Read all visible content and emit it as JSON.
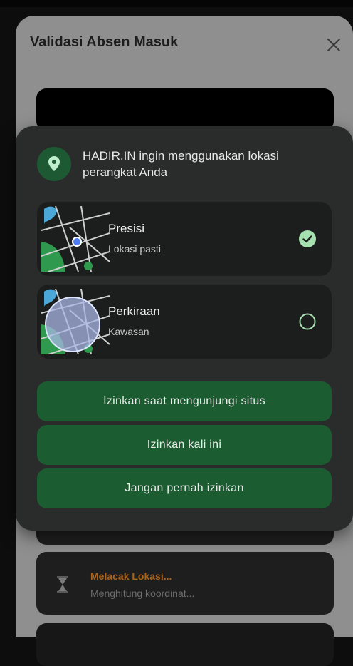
{
  "background": {
    "sheet_title": "Validasi Absen Masuk",
    "tracking_card": {
      "title": "Melacak Lokasi...",
      "subtitle": "Menghitung koordinat..."
    }
  },
  "permission_dialog": {
    "message": "HADIR.IN ingin menggunakan lokasi perangkat Anda",
    "options": [
      {
        "title": "Presisi",
        "subtitle": "Lokasi pasti",
        "selected": true
      },
      {
        "title": "Perkiraan",
        "subtitle": "Kawasan",
        "selected": false
      }
    ],
    "buttons": {
      "while_visiting": "Izinkan saat mengunjungi situs",
      "only_this_time": "Izinkan kali ini",
      "never": "Jangan pernah izinkan"
    }
  },
  "colors": {
    "accent_green": "#1b5c31",
    "check_green": "#a6dfb0",
    "dialog_bg": "#2a2c2b",
    "option_bg": "#1c1e1d",
    "tracking_title": "#a9641b"
  },
  "icons": [
    "close-icon",
    "location-pin-icon",
    "precise-map-icon",
    "approximate-map-icon",
    "check-circle-icon",
    "radio-empty-icon",
    "hourglass-icon"
  ]
}
